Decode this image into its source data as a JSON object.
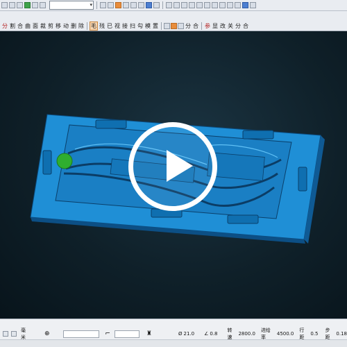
{
  "toolbar_top": {
    "layer_value": "",
    "icons": [
      "folder-icon",
      "save-icon",
      "print-icon",
      "filter-icon",
      "undo-icon",
      "redo-icon",
      "color-wheel-icon",
      "cut-icon",
      "copy-icon",
      "paste-icon",
      "select-icon",
      "view-icon"
    ]
  },
  "toolbar_cmds": {
    "left": [
      "分",
      "割",
      "合",
      "曲",
      "面",
      "裁",
      "剪",
      "移",
      "动",
      "删",
      "除"
    ],
    "mid": [
      "毛",
      "残",
      "已",
      "视",
      "接",
      "扫",
      "勾",
      "模",
      "置"
    ],
    "right_a": [
      "分",
      "合"
    ],
    "right_b": [
      "参",
      "显",
      "改",
      "关",
      "分",
      "合"
    ]
  },
  "viewport": {
    "play_button_label": "",
    "model": "mold-plate-3d"
  },
  "status_bar": {
    "unit": "毫米",
    "tool_diameter_label": "Ø",
    "tool_diameter": "21.0",
    "corner_label": "∠",
    "corner_value": "0.8",
    "spindle_label": "转速",
    "spindle_value": "2800.0",
    "feed_label": "进给率",
    "feed_value": "4500.0",
    "step_label": "行距",
    "step_value": "0.5",
    "depth_label": "步距",
    "depth_value": "0.18"
  },
  "colors": {
    "model_blue": "#1f8fd6",
    "model_shadow": "#0c4f85",
    "cursor_green": "#2fae2f",
    "background": "#0f2029"
  }
}
